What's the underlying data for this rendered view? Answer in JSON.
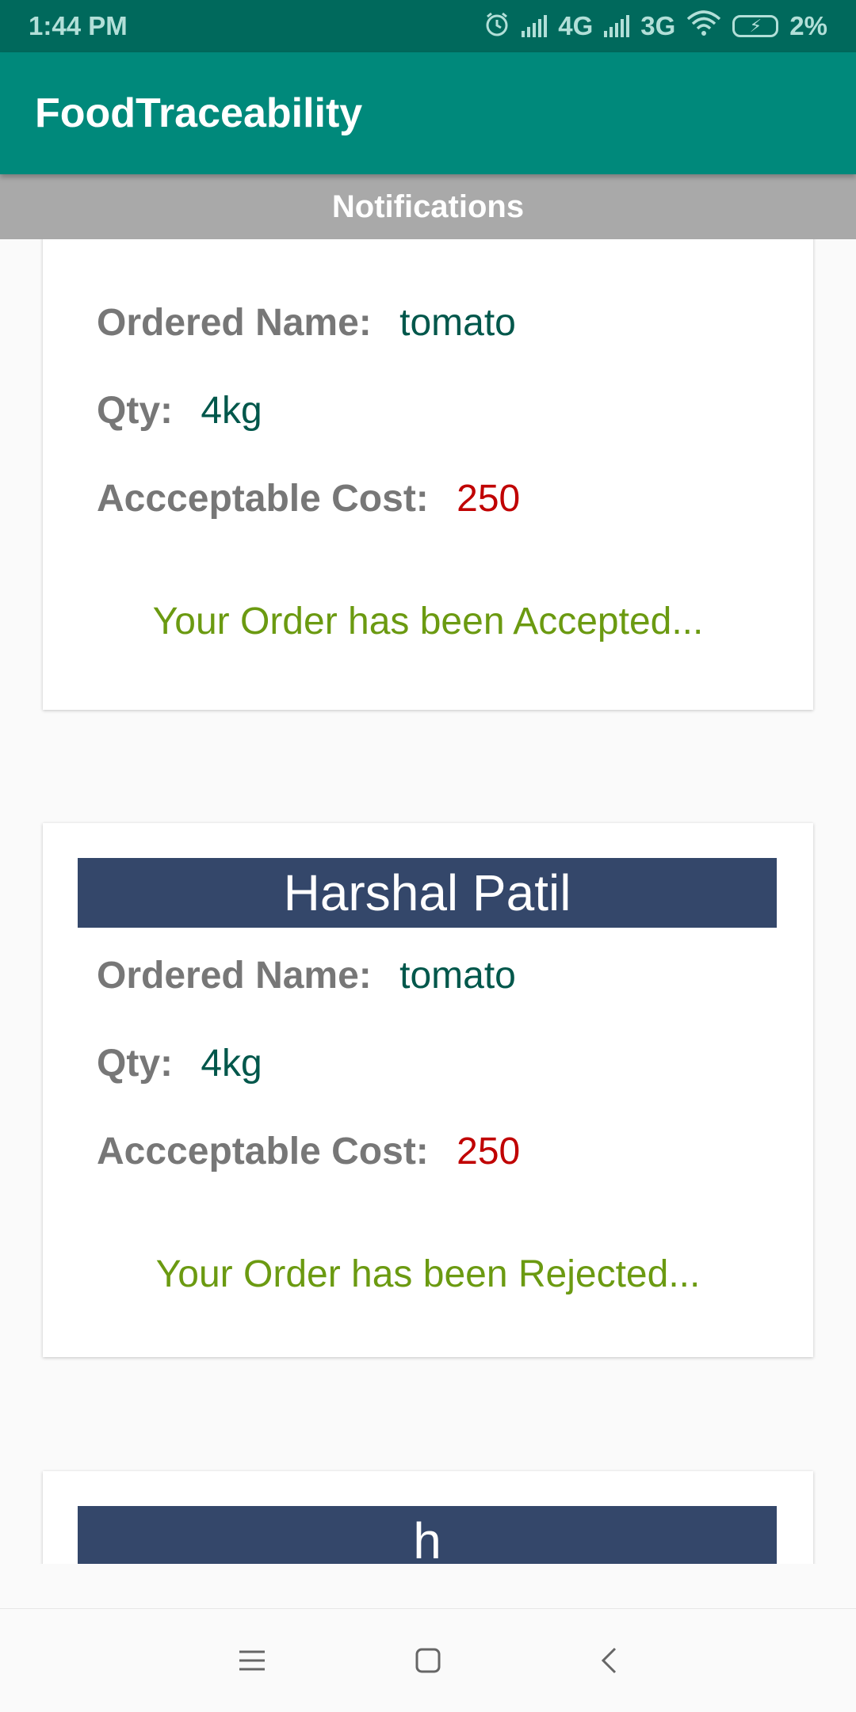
{
  "status_bar": {
    "time": "1:44 PM",
    "network_1": "4G",
    "network_2": "3G",
    "battery": "2%",
    "icons": [
      "alarm-icon",
      "signal-icon",
      "signal-icon",
      "wifi-icon",
      "battery-charging-icon"
    ]
  },
  "app": {
    "title": "FoodTraceability"
  },
  "header": {
    "title": "Notifications"
  },
  "labels": {
    "ordered_name": "Ordered Name:",
    "qty": "Qty:",
    "cost": "Accceptable Cost:"
  },
  "cards": [
    {
      "name": "",
      "ordered_name": "tomato",
      "qty": "4kg",
      "cost": "250",
      "status": "Your Order has been Accepted..."
    },
    {
      "name": "Harshal Patil",
      "ordered_name": "tomato",
      "qty": "4kg",
      "cost": "250",
      "status": "Your Order has been Rejected..."
    },
    {
      "name": "h"
    }
  ],
  "nav": {
    "icons": [
      "menu-icon",
      "home-icon",
      "back-icon"
    ]
  },
  "colors": {
    "status_bar": "#00695c",
    "app_bar": "#00897b",
    "header": "#a9a9a9",
    "name_banner": "#34476a",
    "cost": "#c00000",
    "status_text": "#6b9a11"
  }
}
